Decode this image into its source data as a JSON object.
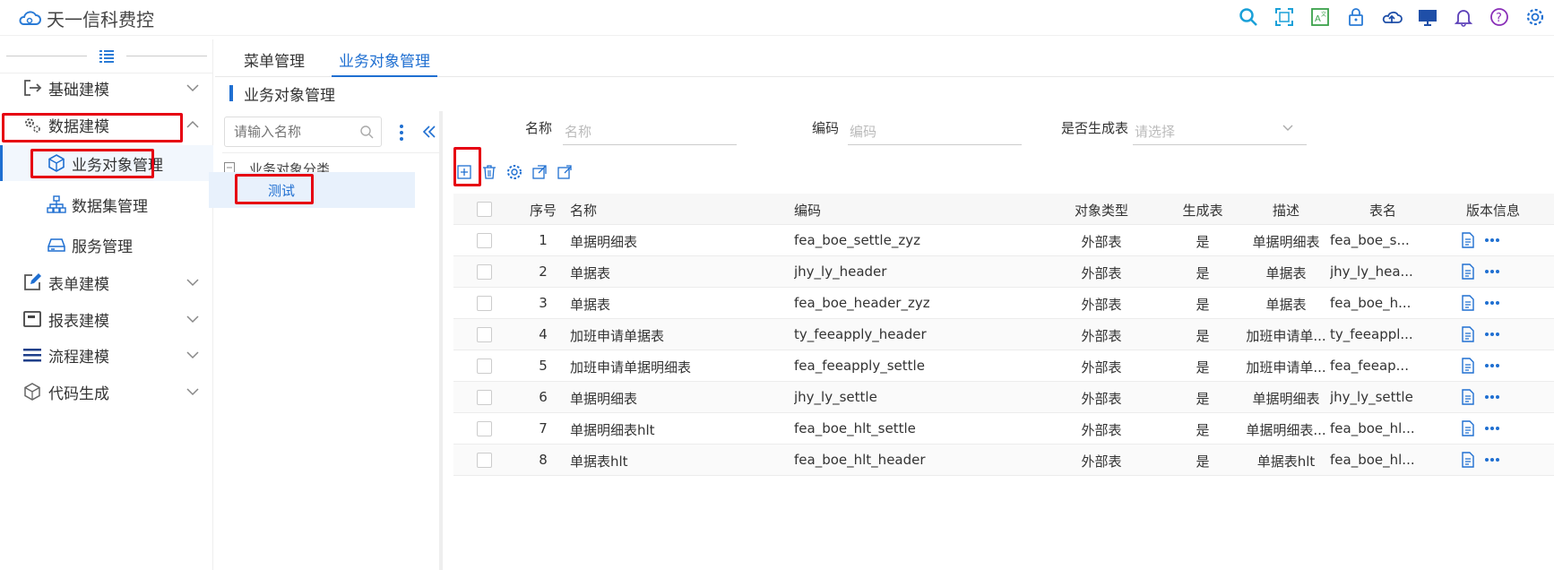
{
  "app": {
    "title": "天一信科费控"
  },
  "sidebar": {
    "items": [
      {
        "label": "基础建模",
        "icon": "exit-icon"
      },
      {
        "label": "数据建模",
        "icon": "cogs-icon"
      },
      {
        "label": "表单建模",
        "icon": "edit-icon"
      },
      {
        "label": "报表建模",
        "icon": "report-icon"
      },
      {
        "label": "流程建模",
        "icon": "list-icon"
      },
      {
        "label": "代码生成",
        "icon": "cube-icon"
      }
    ],
    "subitems": [
      {
        "label": "业务对象管理",
        "icon": "cube-outline-icon"
      },
      {
        "label": "数据集管理",
        "icon": "sitemap-icon"
      },
      {
        "label": "服务管理",
        "icon": "drive-icon"
      }
    ]
  },
  "tabs": [
    {
      "label": "菜单管理"
    },
    {
      "label": "业务对象管理"
    }
  ],
  "breadcrumb": "业务对象管理",
  "tree": {
    "search_placeholder": "请输入名称",
    "root_label": "业务对象分类",
    "leaf_label": "测试"
  },
  "filters": {
    "name_label": "名称",
    "name_placeholder": "名称",
    "code_label": "编码",
    "code_placeholder": "编码",
    "gen_label": "是否生成表",
    "gen_placeholder": "请选择"
  },
  "table": {
    "headers": {
      "idx": "序号",
      "name": "名称",
      "code": "编码",
      "type": "对象类型",
      "gen": "生成表",
      "desc": "描述",
      "table": "表名",
      "ver": "版本信息"
    },
    "rows": [
      {
        "idx": "1",
        "name": "单据明细表",
        "code": "fea_boe_settle_zyz",
        "type": "外部表",
        "gen": "是",
        "desc": "单据明细表",
        "table": "fea_boe_s..."
      },
      {
        "idx": "2",
        "name": "单据表",
        "code": "jhy_ly_header",
        "type": "外部表",
        "gen": "是",
        "desc": "单据表",
        "table": "jhy_ly_hea..."
      },
      {
        "idx": "3",
        "name": "单据表",
        "code": "fea_boe_header_zyz",
        "type": "外部表",
        "gen": "是",
        "desc": "单据表",
        "table": "fea_boe_h..."
      },
      {
        "idx": "4",
        "name": "加班申请单据表",
        "code": "ty_feeapply_header",
        "type": "外部表",
        "gen": "是",
        "desc": "加班申请单...",
        "table": "ty_feeappl..."
      },
      {
        "idx": "5",
        "name": "加班申请单据明细表",
        "code": "fea_feeapply_settle",
        "type": "外部表",
        "gen": "是",
        "desc": "加班申请单...",
        "table": "fea_feeap..."
      },
      {
        "idx": "6",
        "name": "单据明细表",
        "code": "jhy_ly_settle",
        "type": "外部表",
        "gen": "是",
        "desc": "单据明细表",
        "table": "jhy_ly_settle"
      },
      {
        "idx": "7",
        "name": "单据明细表hlt",
        "code": "fea_boe_hlt_settle",
        "type": "外部表",
        "gen": "是",
        "desc": "单据明细表...",
        "table": "fea_boe_hl..."
      },
      {
        "idx": "8",
        "name": "单据表hlt",
        "code": "fea_boe_hlt_header",
        "type": "外部表",
        "gen": "是",
        "desc": "单据表hlt",
        "table": "fea_boe_hl..."
      }
    ]
  },
  "colors": {
    "accent": "#1f6fd1",
    "highlight": "#e60012"
  }
}
